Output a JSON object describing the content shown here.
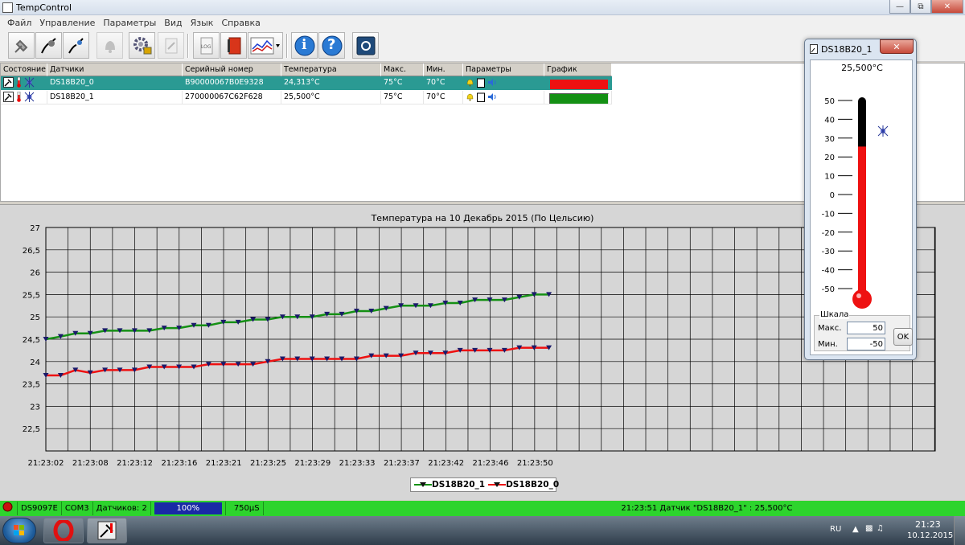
{
  "window": {
    "title": "TempControl"
  },
  "menu": [
    "Файл",
    "Управление",
    "Параметры",
    "Вид",
    "Язык",
    "Справка"
  ],
  "toolbar": {
    "buttons": [
      {
        "name": "connect-sensor-button",
        "icon": "usb-plug-icon"
      },
      {
        "name": "connect-sensor-alt-button",
        "icon": "sensor-plug-icon"
      },
      {
        "name": "disconnect-sensor-button",
        "icon": "sensor-unplug-icon"
      },
      {
        "name": "alarm-button",
        "icon": "bell-icon"
      },
      {
        "name": "settings-button",
        "icon": "gear-icon"
      },
      {
        "name": "edit-button",
        "icon": "pencil-icon"
      },
      {
        "name": "log-button",
        "icon": "log-icon",
        "label": "LOG"
      },
      {
        "name": "notebook-button",
        "icon": "notebook-icon"
      },
      {
        "name": "chart-button",
        "icon": "line-chart-icon"
      },
      {
        "name": "info-button",
        "icon": "info-icon",
        "label": "i"
      },
      {
        "name": "help-button",
        "icon": "help-icon",
        "label": "?"
      },
      {
        "name": "monitor-button",
        "icon": "monitor-icon"
      }
    ]
  },
  "sensor_table": {
    "columns": [
      "Состояние",
      "Датчики",
      "Серийный номер",
      "Температура",
      "Макс.",
      "Мин.",
      "Параметры",
      "График"
    ],
    "rows": [
      {
        "name": "DS18B20_0",
        "serial": "B90000067B0E9328",
        "temperature": "24,313°C",
        "max": "75°C",
        "min": "70°C",
        "graph_color": "#ee1111",
        "selected": true
      },
      {
        "name": "DS18B20_1",
        "serial": "270000067C62F628",
        "temperature": "25,500°C",
        "max": "75°C",
        "min": "70°C",
        "graph_color": "#149014",
        "selected": false
      }
    ]
  },
  "chart_data": {
    "type": "line",
    "title": "Температура на 10 Декабрь 2015 (По Цельсию)",
    "xlabel": "",
    "ylabel": "",
    "ylim": [
      22,
      27
    ],
    "yticks": [
      "27",
      "26,5",
      "26",
      "25,5",
      "25",
      "24,5",
      "24",
      "23,5",
      "23",
      "22,5"
    ],
    "xticks": [
      "21:23:02",
      "21:23:08",
      "21:23:12",
      "21:23:16",
      "21:23:21",
      "21:23:25",
      "21:23:29",
      "21:23:33",
      "21:23:37",
      "21:23:42",
      "21:23:46",
      "21:23:50"
    ],
    "grid": true,
    "legend": "bottom-center",
    "series": [
      {
        "name": "DS18B20_1",
        "color": "#149014",
        "values": [
          24.5,
          24.56,
          24.63,
          24.63,
          24.69,
          24.69,
          24.69,
          24.69,
          24.75,
          24.75,
          24.81,
          24.81,
          24.88,
          24.88,
          24.94,
          24.94,
          25.0,
          25.0,
          25.0,
          25.06,
          25.06,
          25.13,
          25.13,
          25.19,
          25.25,
          25.25,
          25.25,
          25.31,
          25.31,
          25.38,
          25.38,
          25.38,
          25.44,
          25.5,
          25.5
        ]
      },
      {
        "name": "DS18B20_0",
        "color": "#ee1111",
        "values": [
          23.69,
          23.69,
          23.81,
          23.75,
          23.81,
          23.81,
          23.81,
          23.88,
          23.88,
          23.88,
          23.88,
          23.94,
          23.94,
          23.94,
          23.94,
          24.0,
          24.06,
          24.06,
          24.06,
          24.06,
          24.06,
          24.06,
          24.13,
          24.13,
          24.13,
          24.19,
          24.19,
          24.19,
          24.25,
          24.25,
          24.25,
          24.25,
          24.31,
          24.31,
          24.31
        ]
      }
    ]
  },
  "status": {
    "device": "DS9097E",
    "port": "COM3",
    "sensors": "Датчиков: 2",
    "progress_label": "100%",
    "progress": 1.0,
    "interval": "750µS",
    "message": "21:23:51 Датчик \"DS18B20_1\" : 25,500°C"
  },
  "thermometer": {
    "title": "DS18B20_1",
    "value_label": "25,500°C",
    "value": 25.5,
    "scale_max": 50,
    "scale_min": -50,
    "ticks": [
      "50",
      "40",
      "30",
      "20",
      "10",
      "0",
      "-10",
      "-20",
      "-30",
      "-40",
      "-50"
    ],
    "scale_label": "Шкала",
    "max_label": "Макс.",
    "min_label": "Мин.",
    "max_value": "50",
    "min_value": "-50",
    "ok_label": "OK"
  },
  "taskbar": {
    "lang": "RU",
    "time": "21:23",
    "date": "10.12.2015"
  }
}
